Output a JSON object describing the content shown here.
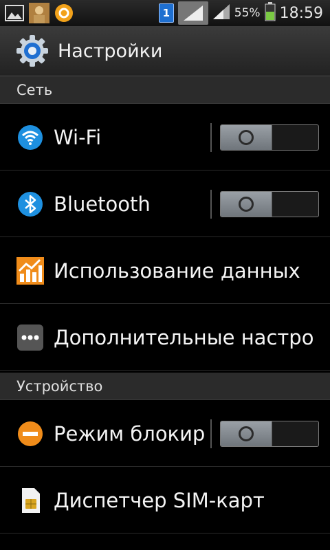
{
  "status_bar": {
    "icons_left": [
      "gallery-icon",
      "contact-photo-icon",
      "app-o-icon"
    ],
    "sim_badge": "1",
    "battery_percent": "55%",
    "time": "18:59"
  },
  "action_bar": {
    "title": "Настройки",
    "icon": "gear-icon"
  },
  "sections": [
    {
      "header": "Сеть",
      "items": [
        {
          "label": "Wi-Fi",
          "icon": "wifi-icon",
          "toggle": "off"
        },
        {
          "label": "Bluetooth",
          "icon": "bluetooth-icon",
          "toggle": "off"
        },
        {
          "label": "Использование данных",
          "icon": "data-usage-icon"
        },
        {
          "label": "Дополнительные настро",
          "icon": "more-icon"
        }
      ]
    },
    {
      "header": "Устройство",
      "items": [
        {
          "label": "Режим блокир",
          "icon": "block-mode-icon",
          "toggle": "off"
        },
        {
          "label": "Диспетчер SIM-карт",
          "icon": "sim-card-icon"
        }
      ]
    }
  ],
  "colors": {
    "accent_blue": "#1e90e0",
    "orange": "#f08c1a",
    "background": "#000000"
  }
}
